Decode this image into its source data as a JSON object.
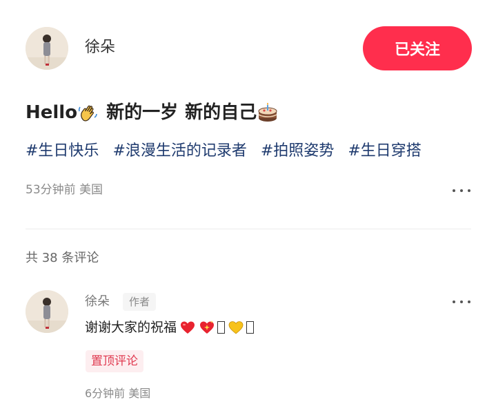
{
  "colors": {
    "accent": "#ff2e4d",
    "hashtag": "#1e3a6e",
    "pinned_text": "#e03a50",
    "pinned_bg": "#fdeef0"
  },
  "author": {
    "name": "徐朵",
    "avatar_icon": "avatar-photo-icon",
    "follow_label": "已关注"
  },
  "post": {
    "title_parts": [
      "Hello",
      "新的一岁",
      "新的自己"
    ],
    "title_icons": [
      "waving-hand-icon",
      "birthday-cake-icon"
    ],
    "hashtags": [
      "#生日快乐",
      "#浪漫生活的记录者",
      "#拍照姿势",
      "#生日穿搭"
    ],
    "time": "53分钟前",
    "location": "美国",
    "more_icon": "more-dots-icon"
  },
  "comments": {
    "count_text": "共 38 条评论",
    "items": [
      {
        "author": "徐朵",
        "badge": "作者",
        "text": "谢谢大家的祝福",
        "emoji_icons": [
          "red-heart-icon",
          "sparkling-heart-icon",
          "yellow-heart-icon"
        ],
        "pinned_label": "置顶评论",
        "time": "6分钟前",
        "location": "美国"
      }
    ]
  }
}
